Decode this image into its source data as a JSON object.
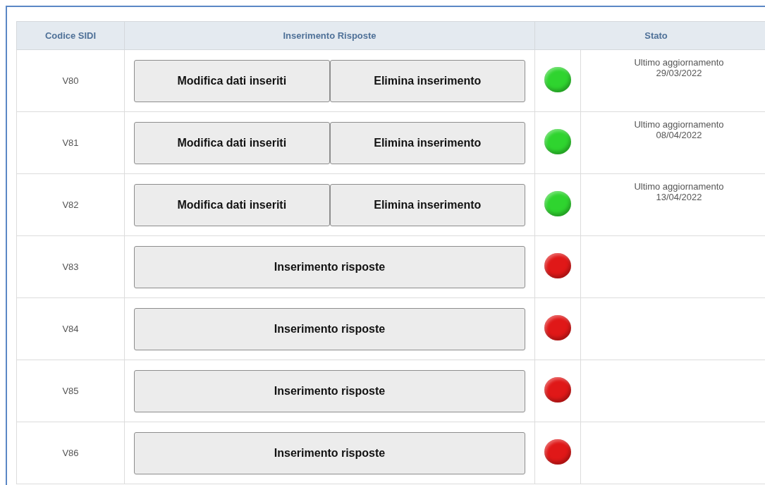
{
  "table": {
    "columns": [
      "Codice SIDI",
      "Inserimento Risposte",
      "Stato"
    ],
    "rows": [
      {
        "code": "V80",
        "buttons": [
          "Modifica dati inseriti",
          "Elimina inserimento"
        ],
        "color": "#2fd42f",
        "status": [
          "Ultimo aggiornamento",
          "29/03/2022"
        ]
      },
      {
        "code": "V81",
        "buttons": [
          "Modifica dati inseriti",
          "Elimina inserimento"
        ],
        "color": "#2fd42f",
        "status": [
          "Ultimo aggiornamento",
          "08/04/2022"
        ]
      },
      {
        "code": "V82",
        "buttons": [
          "Modifica dati inseriti",
          "Elimina inserimento"
        ],
        "color": "#2fd42f",
        "status": [
          "Ultimo aggiornamento",
          "13/04/2022"
        ]
      },
      {
        "code": "V83",
        "buttons": [
          "Inserimento risposte"
        ],
        "color": "#e01818"
      },
      {
        "code": "V84",
        "buttons": [
          "Inserimento risposte"
        ],
        "color": "#e01818"
      },
      {
        "code": "V85",
        "buttons": [
          "Inserimento risposte"
        ],
        "color": "#e01818"
      },
      {
        "code": "V86",
        "buttons": [
          "Inserimento risposte"
        ],
        "color": "#e01818"
      }
    ]
  }
}
